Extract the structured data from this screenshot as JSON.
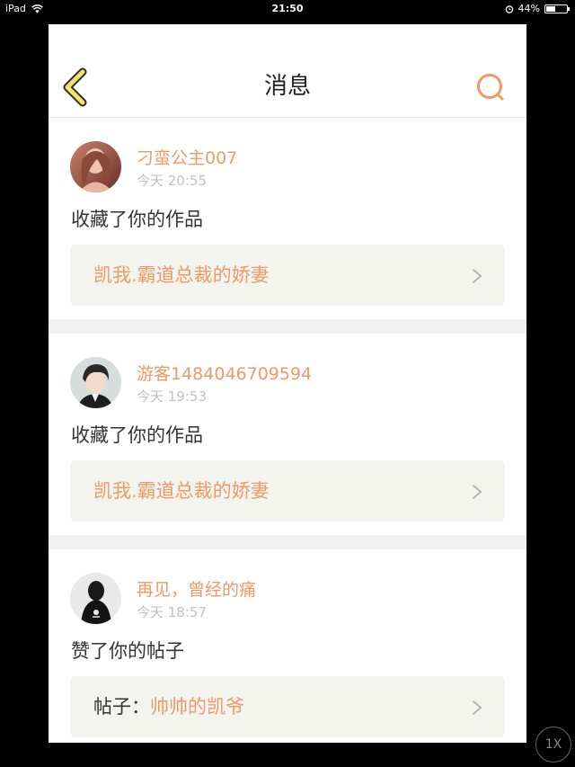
{
  "statusbar": {
    "device": "iPad",
    "time": "21:50",
    "battery_text": "44%",
    "battery_level": 0.44
  },
  "navbar": {
    "title": "消息",
    "back_icon": "chevron-left-icon",
    "search_icon": "search-icon"
  },
  "colors": {
    "accent": "#ee9a66",
    "back_arrow": "#f2e36b",
    "card_bg": "#f4f4ef",
    "separator": "#f1f1f1"
  },
  "messages": [
    {
      "username": "刁蛮公主007",
      "time": "今天 20:55",
      "action": "收藏了你的作品",
      "ref_prefix": "",
      "ref_title": "凯我.霸道总裁的娇妻"
    },
    {
      "username": "游客1484046709594",
      "time": "今天 19:53",
      "action": "收藏了你的作品",
      "ref_prefix": "",
      "ref_title": "凯我.霸道总裁的娇妻"
    },
    {
      "username": "再见，曾经的痛",
      "time": "今天 18:57",
      "action": "赞了你的帖子",
      "ref_prefix": "帖子：",
      "ref_title": "帅帅的凯爷"
    }
  ],
  "zoom_badge": "1X"
}
